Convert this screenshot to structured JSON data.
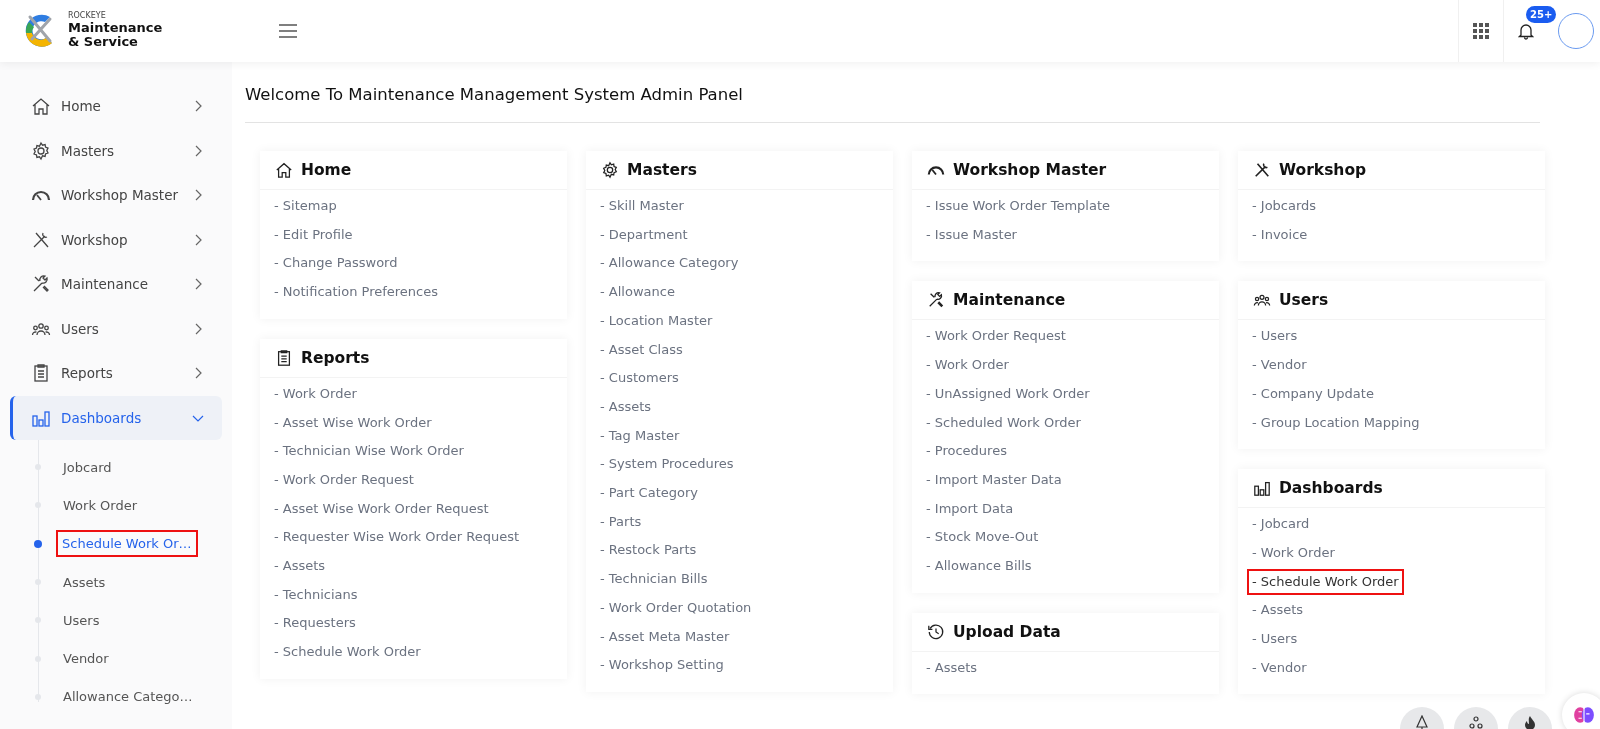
{
  "header": {
    "brand_small": "ROCKEYE",
    "brand_line1": "Maintenance",
    "brand_line2": "& Service",
    "notification_count": "25+"
  },
  "sidebar": {
    "items": [
      {
        "kind": "home",
        "label": "Home",
        "expanded": false,
        "selected": false
      },
      {
        "kind": "gear",
        "label": "Masters",
        "expanded": false,
        "selected": false
      },
      {
        "kind": "gauge",
        "label": "Workshop Master",
        "expanded": false,
        "selected": false
      },
      {
        "kind": "tools",
        "label": "Workshop",
        "expanded": false,
        "selected": false
      },
      {
        "kind": "wrench",
        "label": "Maintenance",
        "expanded": false,
        "selected": false
      },
      {
        "kind": "users",
        "label": "Users",
        "expanded": false,
        "selected": false
      },
      {
        "kind": "clipboard",
        "label": "Reports",
        "expanded": false,
        "selected": false
      },
      {
        "kind": "chart",
        "label": "Dashboards",
        "expanded": true,
        "selected": true,
        "children": [
          {
            "label": "Jobcard",
            "selected": false,
            "highlighted": false
          },
          {
            "label": "Work Order",
            "selected": false,
            "highlighted": false
          },
          {
            "label": "Schedule Work Or…",
            "selected": true,
            "highlighted": true
          },
          {
            "label": "Assets",
            "selected": false,
            "highlighted": false
          },
          {
            "label": "Users",
            "selected": false,
            "highlighted": false
          },
          {
            "label": "Vendor",
            "selected": false,
            "highlighted": false
          },
          {
            "label": "Allowance Catego…",
            "selected": false,
            "highlighted": false
          }
        ]
      }
    ]
  },
  "page_title": "Welcome To Maintenance Management System Admin Panel",
  "columns": [
    [
      {
        "kind": "home",
        "title": "Home",
        "links": [
          "- Sitemap",
          "- Edit Profile",
          "- Change Password",
          "- Notification Preferences"
        ]
      },
      {
        "kind": "clipboard",
        "title": "Reports",
        "links": [
          "- Work Order",
          "- Asset Wise Work Order",
          "- Technician Wise Work Order",
          "- Work Order Request",
          "- Asset Wise Work Order Request",
          "- Requester Wise Work Order Request",
          "- Assets",
          "- Technicians",
          "- Requesters",
          "- Schedule Work Order"
        ]
      }
    ],
    [
      {
        "kind": "gear",
        "title": "Masters",
        "links": [
          "- Skill Master",
          "- Department",
          "- Allowance Category",
          "- Allowance",
          "- Location Master",
          "- Asset Class",
          "- Customers",
          "- Assets",
          "- Tag Master",
          "- System Procedures",
          "- Part Category",
          "- Parts",
          "- Restock Parts",
          "- Technician Bills",
          "- Work Order Quotation",
          "- Asset Meta Master",
          "- Workshop Setting"
        ]
      }
    ],
    [
      {
        "kind": "gauge",
        "title": "Workshop Master",
        "links": [
          "- Issue Work Order Template",
          "- Issue Master"
        ]
      },
      {
        "kind": "wrench",
        "title": "Maintenance",
        "links": [
          "- Work Order Request",
          "- Work Order",
          "- UnAssigned Work Order",
          "- Scheduled Work Order",
          "- Procedures",
          "- Import Master Data",
          "- Import Data",
          "- Stock Move-Out",
          "- Allowance Bills"
        ]
      },
      {
        "kind": "history",
        "title": "Upload Data",
        "links": [
          "- Assets"
        ]
      }
    ],
    [
      {
        "kind": "tools",
        "title": "Workshop",
        "links": [
          "- Jobcards",
          "- Invoice"
        ]
      },
      {
        "kind": "users",
        "title": "Users",
        "links": [
          "- Users",
          "- Vendor",
          "- Company Update",
          "- Group Location Mapping"
        ]
      },
      {
        "kind": "chart",
        "title": "Dashboards",
        "links": [
          {
            "label": "- Jobcard",
            "highlighted": false
          },
          {
            "label": "- Work Order",
            "highlighted": false
          },
          {
            "label": "- Schedule Work Order",
            "highlighted": true
          },
          {
            "label": "- Assets",
            "highlighted": false
          },
          {
            "label": "- Users",
            "highlighted": false
          },
          {
            "label": "- Vendor",
            "highlighted": false
          }
        ]
      }
    ]
  ]
}
